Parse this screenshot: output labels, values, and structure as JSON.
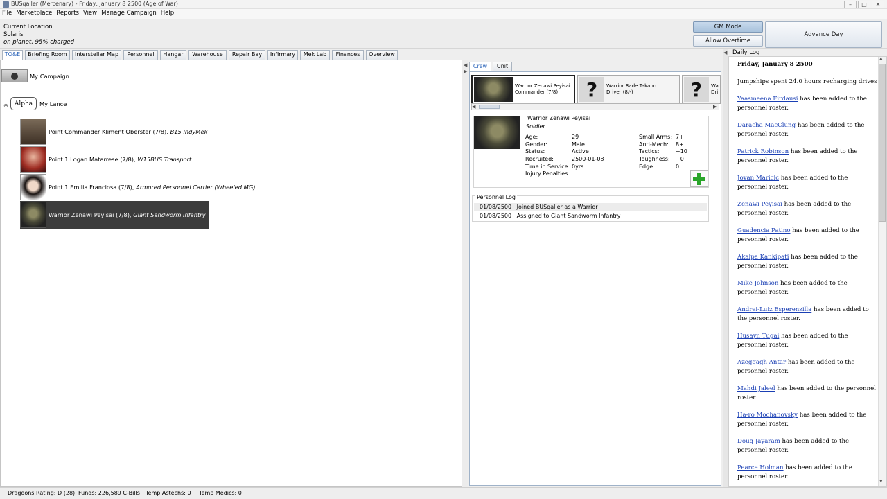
{
  "window": {
    "title": "BUSqaller (Mercenary) - Friday, January 8 2500 (Age of War)"
  },
  "menu": [
    "File",
    "Marketplace",
    "Reports",
    "View",
    "Manage Campaign",
    "Help"
  ],
  "location": {
    "heading": "Current Location",
    "place": "Solaris",
    "status": "on planet, 95% charged"
  },
  "buttons": {
    "gm_mode": "GM Mode",
    "allow_overtime": "Allow Overtime",
    "advance_day": "Advance Day"
  },
  "tabs": [
    "TO&E",
    "Briefing Room",
    "Interstellar Map",
    "Personnel",
    "Hangar",
    "Warehouse",
    "Repair Bay",
    "Infirmary",
    "Mek Lab",
    "Finances",
    "Overview"
  ],
  "toe": {
    "campaign": "My Campaign",
    "lance_badge": "Alpha",
    "lance_name": "My Lance",
    "members": [
      {
        "name": "Point Commander Kliment Oberster (7/8),",
        "unit": "B15 IndyMek"
      },
      {
        "name": "Point 1 Logan Matarrese (7/8),",
        "unit": "W15BUS Transport"
      },
      {
        "name": "Point 1 Emilia Franciosa (7/8),",
        "unit": "Armored Personnel Carrier (Wheeled MG)"
      },
      {
        "name": "Warrior Zenawi Peyisai (7/8),",
        "unit": "Giant Sandworm Infantry"
      }
    ]
  },
  "detail": {
    "tabs": [
      "Crew",
      "Unit"
    ],
    "crew": [
      {
        "line1": "Warrior Zenawi Peyisai",
        "line2": "Commander (7/8)"
      },
      {
        "line1": "Warrior Rade Takano",
        "line2": "Driver (8/-)"
      },
      {
        "line1": "Wa",
        "line2": "Dri"
      }
    ],
    "person": {
      "name": "Warrior Zenawi Peyisai",
      "role": "Soldier",
      "fields": [
        {
          "k": "Age:",
          "v": "29"
        },
        {
          "k": "Gender:",
          "v": "Male"
        },
        {
          "k": "Status:",
          "v": "Active"
        },
        {
          "k": "Recruited:",
          "v": "2500-01-08"
        },
        {
          "k": "Time in Service:",
          "v": "0yrs"
        },
        {
          "k": "Injury Penalties:",
          "v": ""
        }
      ],
      "skills": [
        {
          "k": "Small Arms:",
          "v": "7+"
        },
        {
          "k": "Anti-Mech:",
          "v": "8+"
        },
        {
          "k": "Tactics:",
          "v": "+10"
        },
        {
          "k": "Toughness:",
          "v": "+0"
        },
        {
          "k": "Edge:",
          "v": "0"
        }
      ]
    },
    "log_title": "Personnel Log",
    "log": [
      {
        "date": "01/08/2500",
        "text": "Joined BUSqaller as a Warrior"
      },
      {
        "date": "01/08/2500",
        "text": "Assigned to Giant Sandworm Infantry"
      }
    ]
  },
  "daily": {
    "label": "Daily Log",
    "date": "Friday, January 8 2500",
    "intro": "Jumpships spent 24.0 hours recharging drives",
    "suffix": " has been added to the personnel roster.",
    "names": [
      "Yaasmeena Firdausi",
      "Daracha MacClung",
      "Patrick Robinson",
      "Jovan Maricic",
      "Zenawi Peyisai",
      "Guadencia Patino",
      "Akalpa Kankipati",
      "Mike Johnson",
      "Andrei-Luiz Esperenzilla",
      "Husayn Tugai",
      "Azeggagh Antar",
      "Mahdi Jaleel",
      "Ha-ro Mochanovsky",
      "Doug Jayaram",
      "Pearce Holman"
    ]
  },
  "status": {
    "rating": "Dragoons Rating: D (28)",
    "funds": "Funds: 226,589 C-Bills",
    "astechs": "Temp Astechs: 0",
    "medics": "Temp Medics: 0"
  }
}
